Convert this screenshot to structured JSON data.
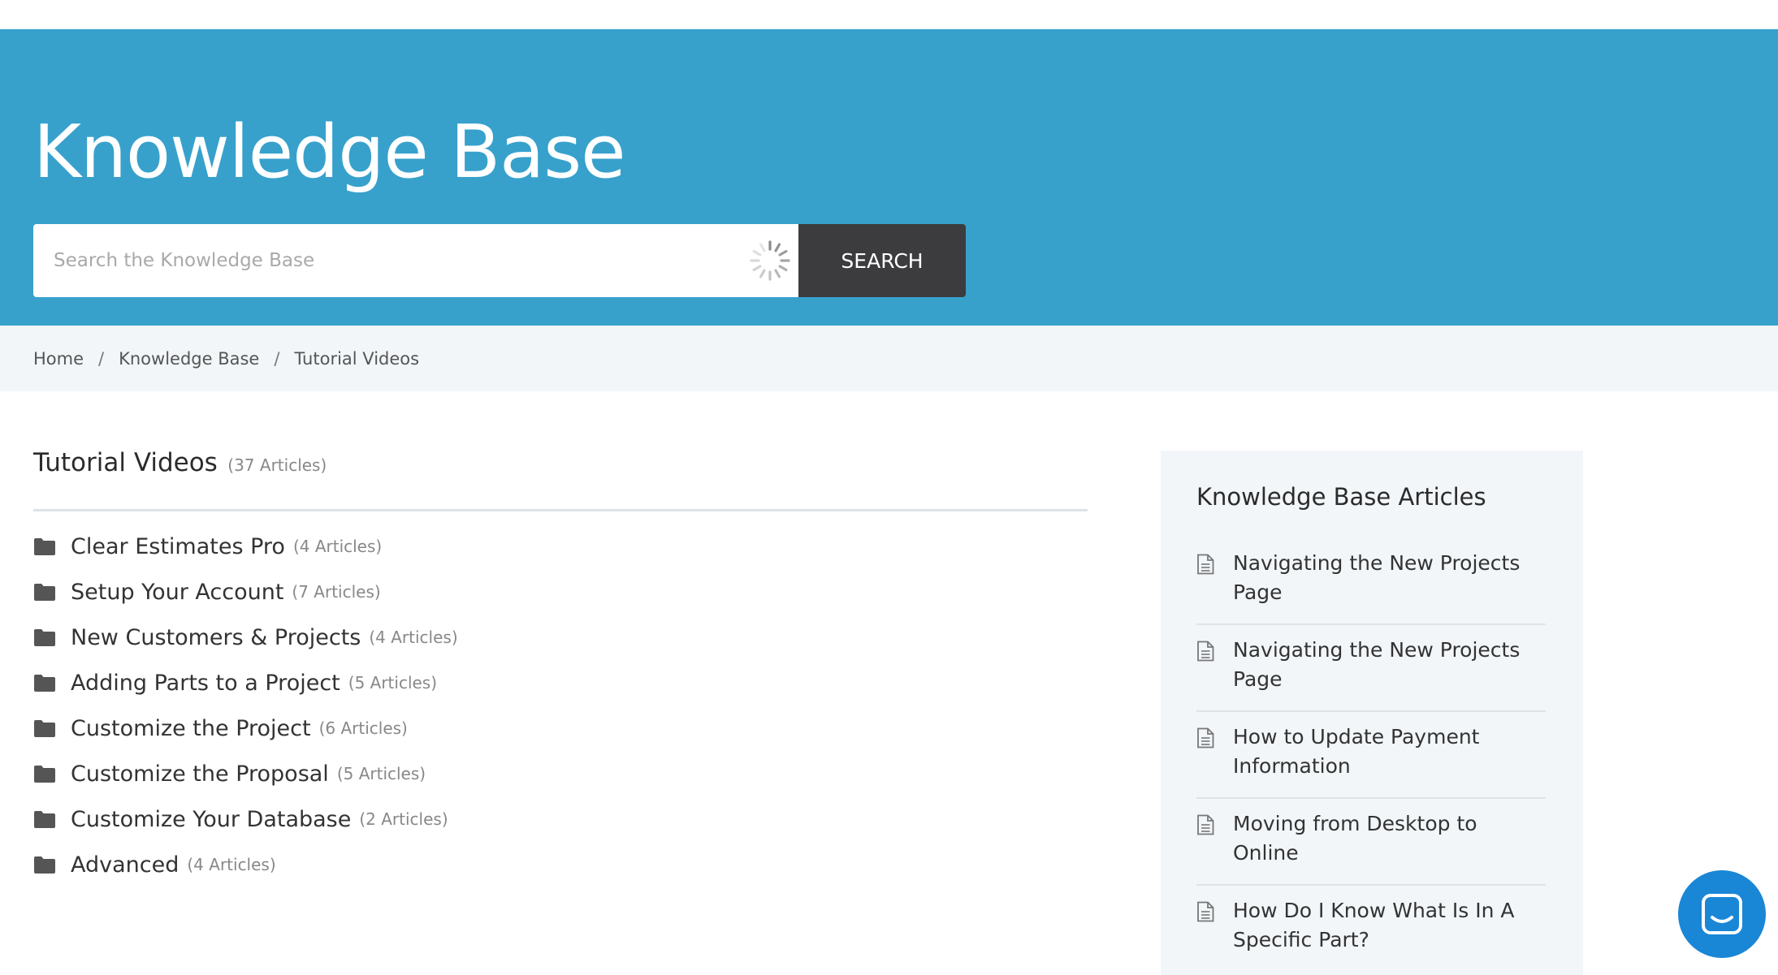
{
  "header": {
    "title": "Knowledge Base",
    "search_placeholder": "Search the Knowledge Base",
    "search_button": "SEARCH",
    "accent_color": "#37a1cc"
  },
  "breadcrumb": {
    "items": [
      "Home",
      "Knowledge Base",
      "Tutorial Videos"
    ],
    "separator": "/"
  },
  "section": {
    "title": "Tutorial Videos",
    "count": "(37 Articles)"
  },
  "categories": [
    {
      "label": "Clear Estimates Pro",
      "count": "(4 Articles)"
    },
    {
      "label": "Setup Your Account",
      "count": "(7 Articles)"
    },
    {
      "label": "New Customers & Projects",
      "count": "(4 Articles)"
    },
    {
      "label": "Adding Parts to a Project",
      "count": "(5 Articles)"
    },
    {
      "label": "Customize the Project",
      "count": "(6 Articles)"
    },
    {
      "label": "Customize the Proposal",
      "count": "(5 Articles)"
    },
    {
      "label": "Customize Your Database",
      "count": "(2 Articles)"
    },
    {
      "label": "Advanced",
      "count": "(4 Articles)"
    }
  ],
  "sidebar": {
    "title": "Knowledge Base Articles",
    "articles": [
      "Navigating the New Projects Page",
      "Navigating the New Projects Page",
      "How to Update Payment Information",
      "Moving from Desktop to Online",
      "How Do I Know What Is In A Specific Part?"
    ]
  },
  "icons": {
    "category": "folder-icon",
    "article": "document-icon",
    "loading": "spinner-icon",
    "chat": "chat-icon"
  }
}
